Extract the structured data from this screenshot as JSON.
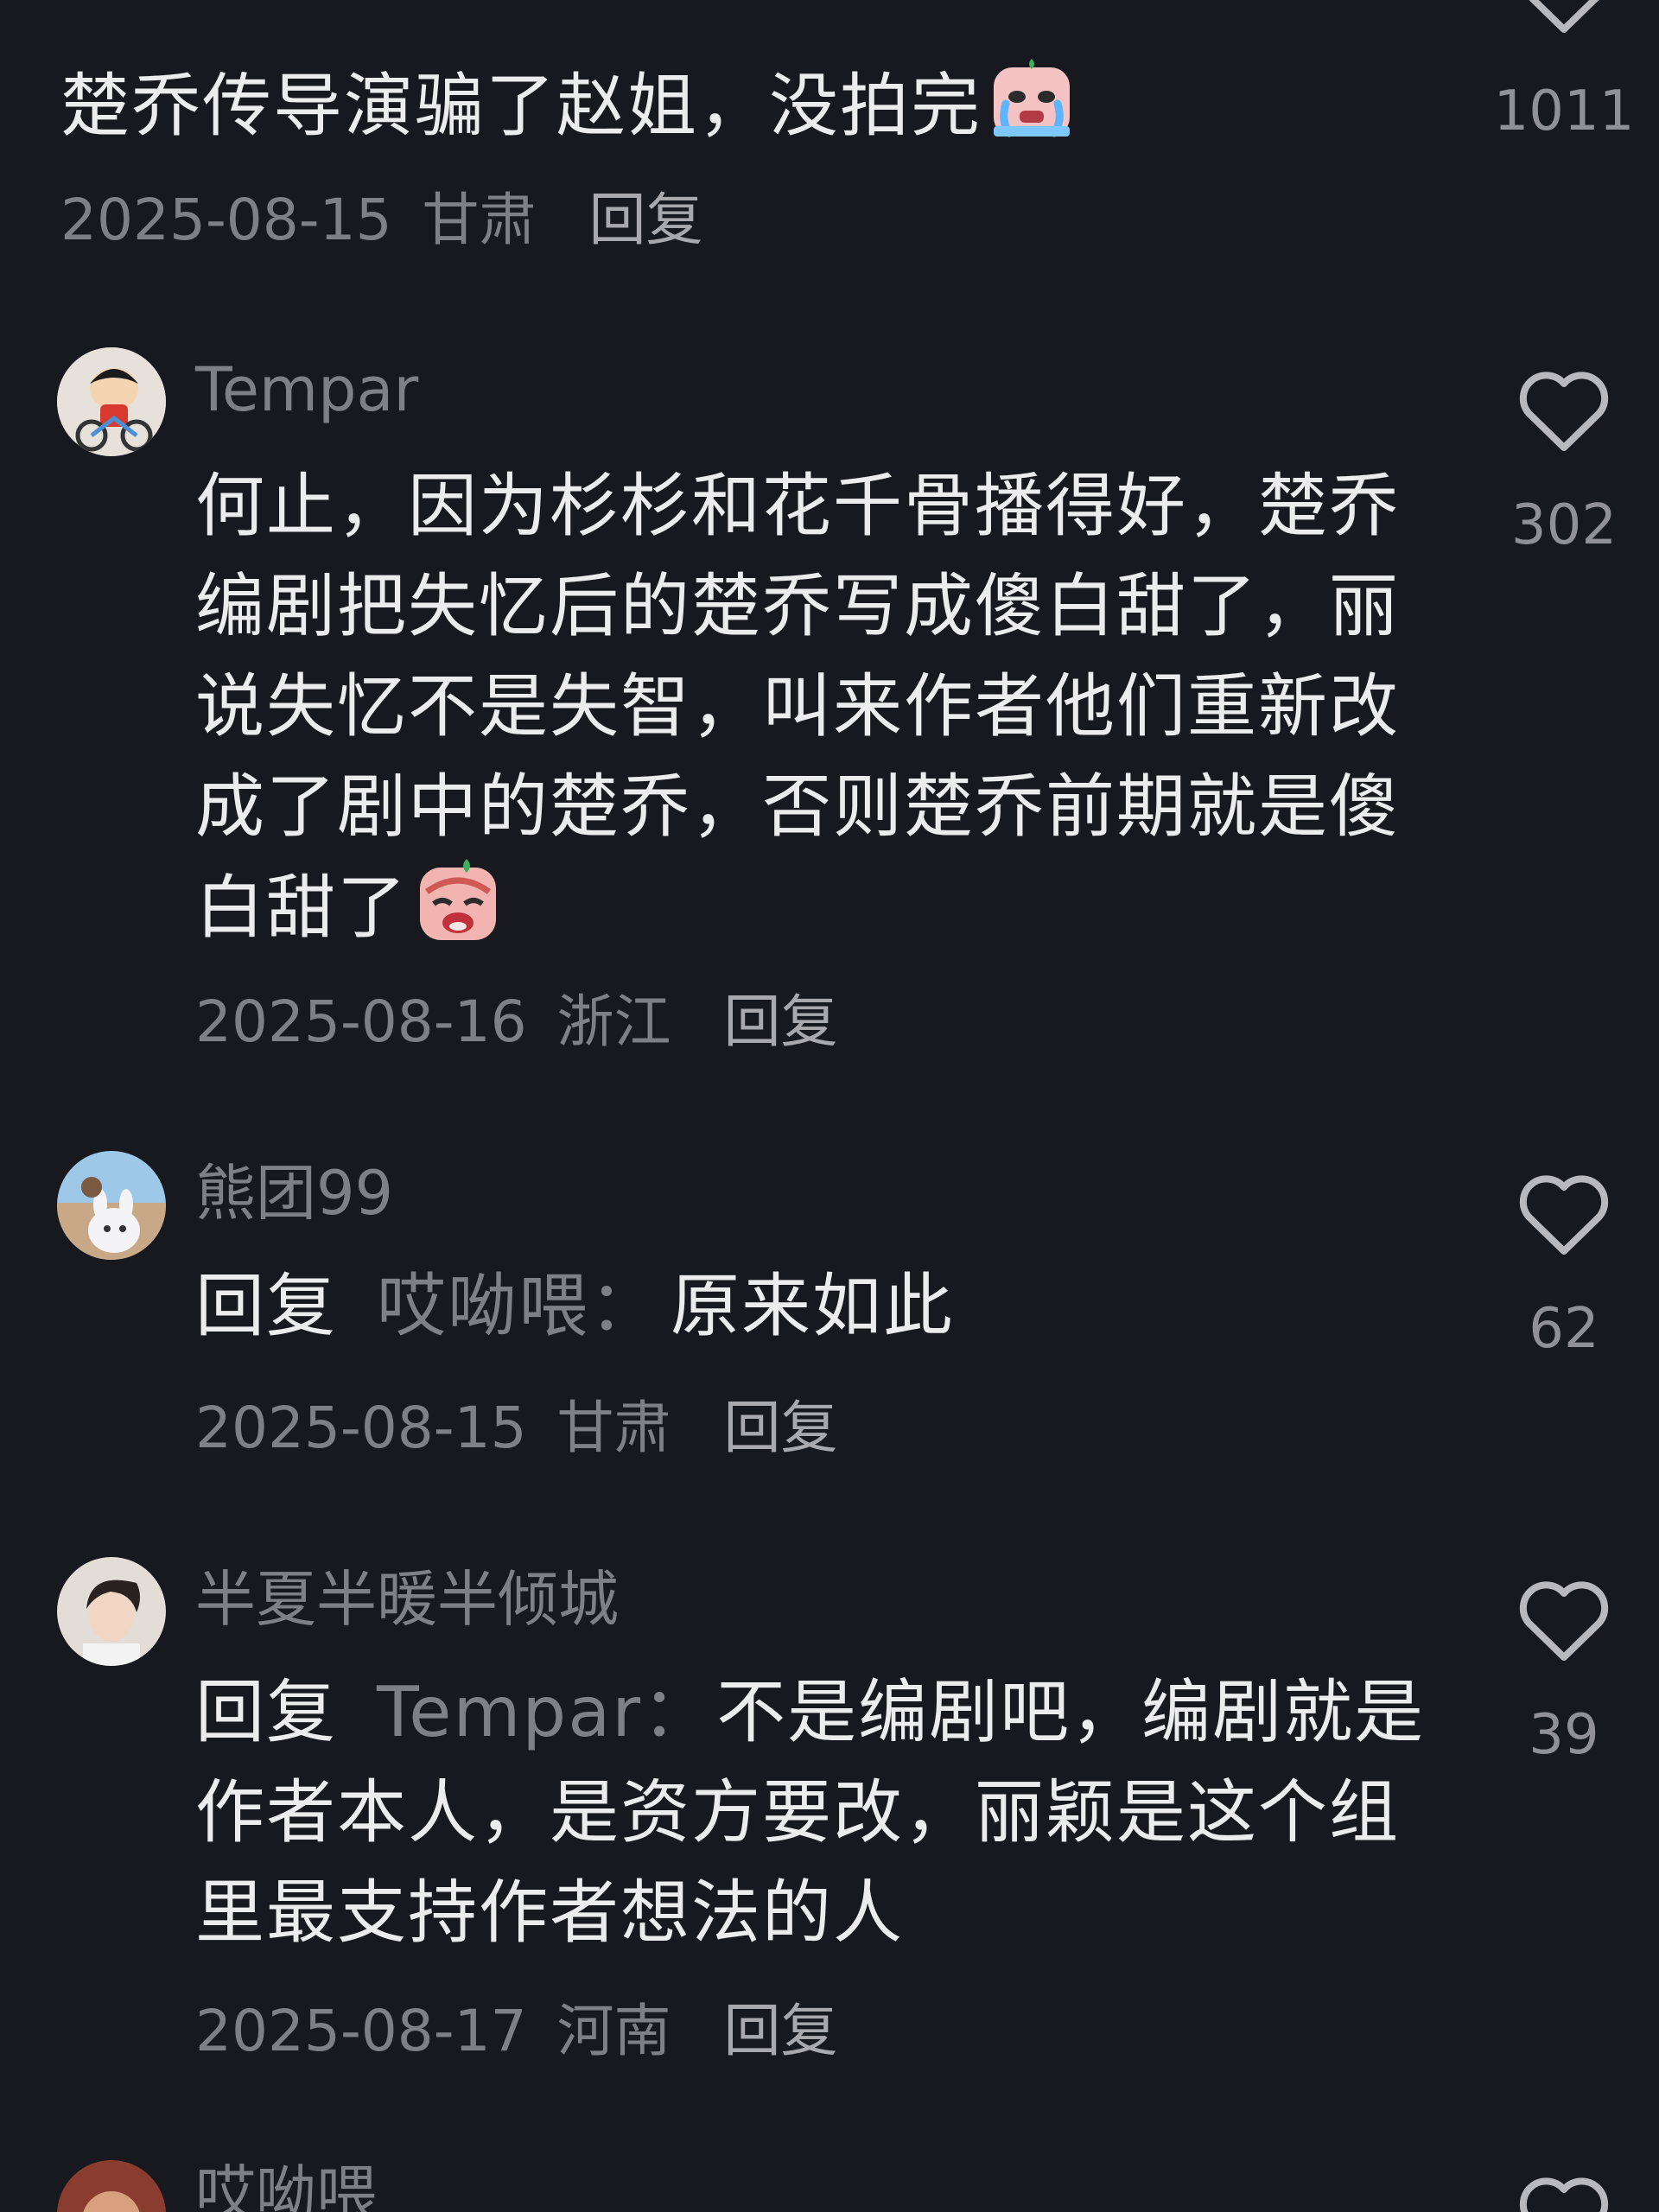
{
  "comments": [
    {
      "username": "",
      "text": "楚乔传导演骗了赵姐，没拍完",
      "emoji": "crying-face-emoji",
      "date": "2025-08-15",
      "location": "甘肃",
      "reply_label": "回复",
      "likes": "1011"
    },
    {
      "username": "Tempar",
      "text": "何止，因为杉杉和花千骨播得好，楚乔编剧把失忆后的楚乔写成傻白甜了，丽说失忆不是失智，叫来作者他们重新改成了剧中的楚乔，否则楚乔前期就是傻白甜了",
      "emoji": "sad-face-emoji",
      "date": "2025-08-16",
      "location": "浙江",
      "reply_label": "回复",
      "likes": "302"
    },
    {
      "username": "熊团99",
      "reply_prefix": "回复",
      "reply_to": "哎呦喂：",
      "text": "原来如此",
      "date": "2025-08-15",
      "location": "甘肃",
      "reply_label": "回复",
      "likes": "62"
    },
    {
      "username": "半夏半暖半倾城",
      "reply_prefix": "回复",
      "reply_to": "Tempar：",
      "text": "不是编剧吧，编剧就是作者本人，是资方要改，丽颖是这个组里最支持作者想法的人",
      "date": "2025-08-17",
      "location": "河南",
      "reply_label": "回复",
      "likes": "39"
    },
    {
      "username": "哎呦喂"
    }
  ],
  "colors": {
    "background": "#18181f",
    "text": "#ececee",
    "muted": "#7f7f86"
  }
}
